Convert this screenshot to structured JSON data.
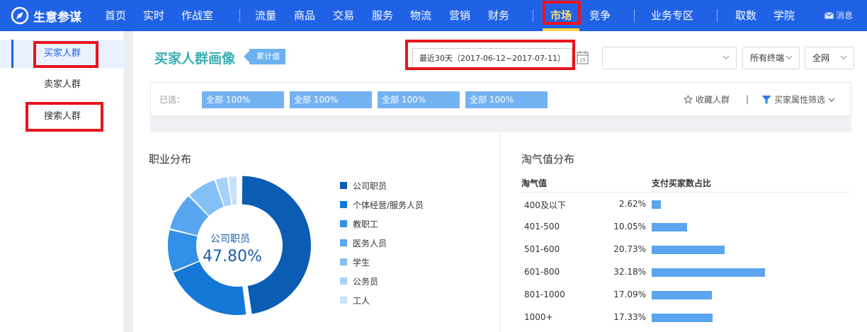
{
  "nav": {
    "brand": "生意参谋",
    "items": [
      "首页",
      "实时",
      "作战室",
      "流量",
      "商品",
      "交易",
      "服务",
      "物流",
      "营销",
      "财务",
      "市场",
      "竞争",
      "业务专区",
      "取数",
      "学院"
    ],
    "active": "市场",
    "message": "消息"
  },
  "sidebar": {
    "items": [
      "买家人群",
      "卖家人群",
      "搜索人群"
    ]
  },
  "header": {
    "title": "买家人群画像",
    "tag": "累计值",
    "date_range": "最近30天（2017-06-12~2017-07-11）",
    "calendar_day": "15",
    "dropdowns": [
      "所有终端",
      "全网"
    ]
  },
  "filters": {
    "label": "已选：",
    "chips": [
      "全部 100%",
      "全部 100%",
      "全部 100%",
      "全部 100%"
    ],
    "favorite": "收藏人群",
    "separator": "|",
    "attr_filter": "买家属性筛选"
  },
  "occupation": {
    "title": "职业分布",
    "center_label": "公司职员",
    "center_value": "47.80%",
    "legend": [
      "公司职员",
      "个体经营/服务人员",
      "教职工",
      "医务人员",
      "学生",
      "公务员",
      "工人"
    ]
  },
  "taoqi": {
    "title": "淘气值分布",
    "col1": "淘气值",
    "col2": "支付买家数占比",
    "rows": [
      {
        "label": "400及以下",
        "value": "2.62%",
        "pct": 2.62
      },
      {
        "label": "401-500",
        "value": "10.05%",
        "pct": 10.05
      },
      {
        "label": "501-600",
        "value": "20.73%",
        "pct": 20.73
      },
      {
        "label": "601-800",
        "value": "32.18%",
        "pct": 32.18
      },
      {
        "label": "801-1000",
        "value": "17.09%",
        "pct": 17.09
      },
      {
        "label": "1000+",
        "value": "17.33%",
        "pct": 17.33
      }
    ]
  },
  "colors": {
    "nav_bg": "#2062e6",
    "accent_teal": "#3aaeb3",
    "bar": "#5aa4f0",
    "highlight": "#e8141c",
    "donut": [
      "#0a5db3",
      "#1479d6",
      "#3390e8",
      "#58a6ef",
      "#82c0f5",
      "#a6d2f8",
      "#c7e3fb"
    ]
  }
}
